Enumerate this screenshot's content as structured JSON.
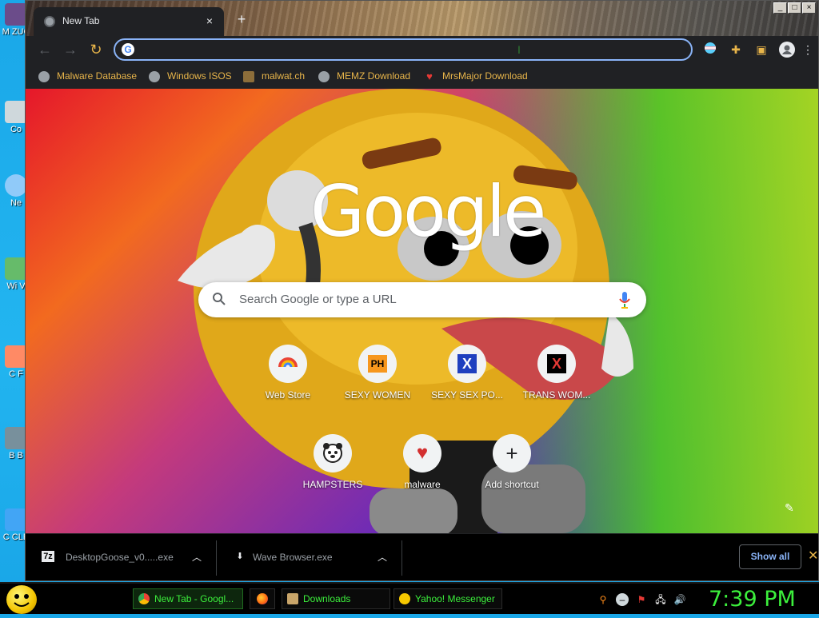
{
  "desktop": {
    "icons": [
      {
        "label": "M ZUC"
      },
      {
        "label": "Co"
      },
      {
        "label": "Ne"
      },
      {
        "label": "Wi V"
      },
      {
        "label": "C F"
      },
      {
        "label": "B B"
      },
      {
        "label": "C CLE"
      }
    ]
  },
  "browser": {
    "tab_title": "New Tab",
    "tab_close": "×",
    "new_tab": "+",
    "window_controls": [
      "_",
      "□",
      "×"
    ],
    "omnibox_placeholder": "",
    "bookmarks": [
      {
        "label": "Malware Database",
        "icon": "globe-icon"
      },
      {
        "label": "Windows ISOS",
        "icon": "globe-icon"
      },
      {
        "label": "malwat.ch",
        "icon": "alien-icon"
      },
      {
        "label": "MEMZ Download",
        "icon": "globe-icon"
      },
      {
        "label": "MrsMajor Download",
        "icon": "heart-icon"
      }
    ]
  },
  "ntp": {
    "logo": "Google",
    "search_placeholder": "Search Google or type a URL",
    "shortcuts_row1": [
      {
        "label": "Web Store",
        "icon": "webstore-icon"
      },
      {
        "label": "SEXY WOMEN",
        "icon": "ph-icon",
        "icon_text": "PH"
      },
      {
        "label": "SEXY SEX PO...",
        "icon": "x-blue-icon",
        "icon_text": "X"
      },
      {
        "label": "TRANS WOM...",
        "icon": "x-red-icon",
        "icon_text": "X"
      }
    ],
    "shortcuts_row2": [
      {
        "label": "HAMPSTERS",
        "icon": "hamster-icon"
      },
      {
        "label": "malware",
        "icon": "heart-icon"
      },
      {
        "label": "Add shortcut",
        "icon": "plus-icon",
        "icon_text": "+"
      }
    ]
  },
  "downloads": {
    "items": [
      {
        "name": "DesktopGoose_v0.....exe",
        "icon_text": "7z"
      },
      {
        "name": "Wave Browser.exe",
        "icon_text": "⬇"
      }
    ],
    "show_all": "Show all",
    "close": "✕"
  },
  "taskbar": {
    "tasks": [
      {
        "label": "New Tab - Googl...",
        "active": true
      },
      {
        "label": "",
        "active": false
      },
      {
        "label": "Downloads",
        "active": false
      },
      {
        "label": "Yahoo! Messenger",
        "active": false
      }
    ],
    "clock": "7:39 PM"
  },
  "colors": {
    "accent": "#8ab4f8",
    "bookmark_text": "#e8b54a",
    "taskbar_text": "#3cf03c"
  }
}
